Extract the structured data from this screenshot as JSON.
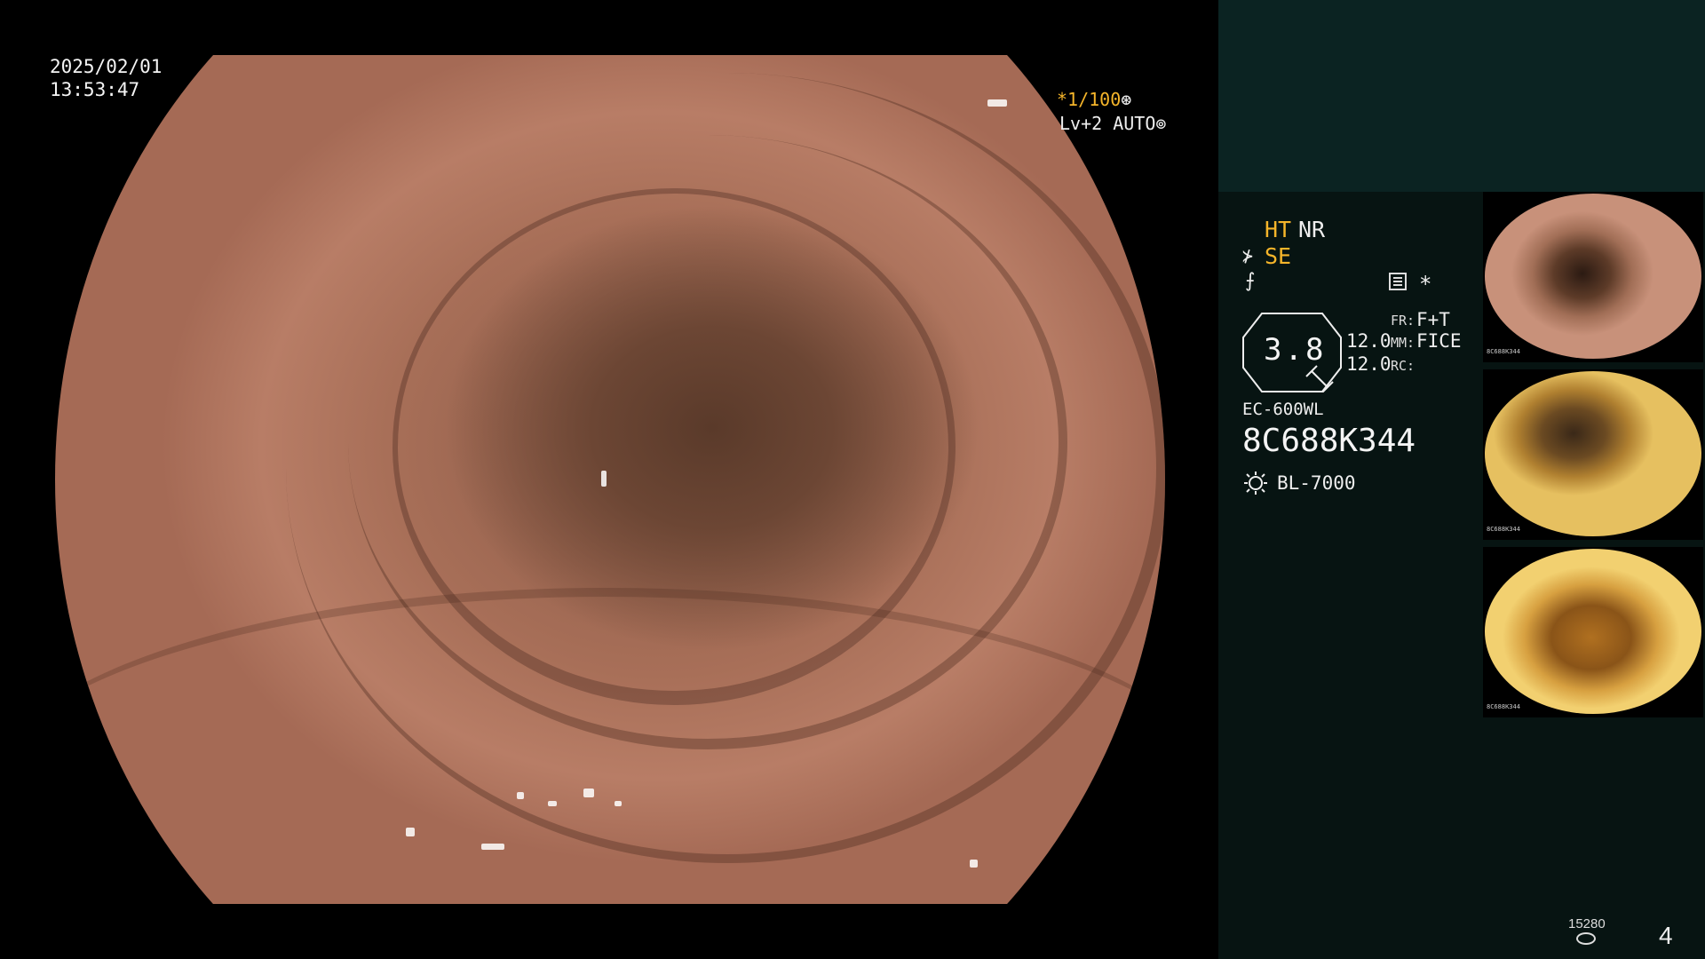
{
  "overlay": {
    "date": "2025/02/01",
    "time": "13:53:47",
    "shutter": "*1/100",
    "shutter_icon": "aperture-icon",
    "level": "Lv+2 AUTO",
    "level_icon": "auto-iris-icon"
  },
  "panel": {
    "mode_ht": "HT",
    "mode_nr": "NR",
    "mode_se_icon": "⊁",
    "mode_se": "SE",
    "f_icon": "⨍",
    "star": "*",
    "gauge_value": "3.8",
    "value_a": "12.0",
    "value_b": "12.0",
    "fr_label": "FR:",
    "fr_value": "F+T",
    "mm_label": "MM:",
    "mm_value": "FICE",
    "rc_label": "RC:",
    "scope_model": "EC-600WL",
    "scope_serial": "8C688K344",
    "light_model": "BL-7000",
    "counter": "15280",
    "page_number": "4"
  },
  "thumbnails": [
    {
      "label": "8C688K344"
    },
    {
      "label": "8C688K344"
    },
    {
      "label": "8C688K344"
    }
  ],
  "colors": {
    "accent_orange": "#f5b52a",
    "panel_bg": "#071412",
    "panel_top_bg": "#0b2322"
  }
}
